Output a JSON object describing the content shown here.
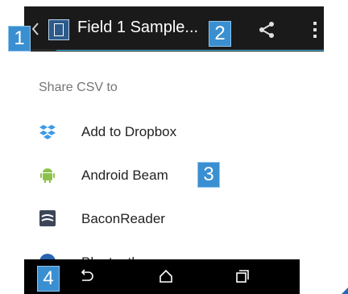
{
  "actionbar": {
    "title": "Field 1 Sample...",
    "icons": [
      "back-chevron-icon",
      "file-icon",
      "share-icon",
      "overflow-menu-icon"
    ]
  },
  "badges": [
    "1",
    "2",
    "3",
    "4"
  ],
  "share_sheet": {
    "title": "Share CSV to",
    "items": [
      {
        "label": "Add to Dropbox",
        "icon": "dropbox-icon"
      },
      {
        "label": "Android Beam",
        "icon": "android-icon"
      },
      {
        "label": "BaconReader",
        "icon": "baconreader-icon"
      },
      {
        "label": "Bluetooth",
        "icon": "bluetooth-icon"
      }
    ]
  },
  "navbar": {
    "buttons": [
      "back-icon",
      "home-icon",
      "recents-icon"
    ]
  },
  "colors": {
    "actionbar_bg": "#1a1a1a",
    "accent": "#33b5e5",
    "badge": "#3a8fd1",
    "nav_bg": "#000000"
  }
}
